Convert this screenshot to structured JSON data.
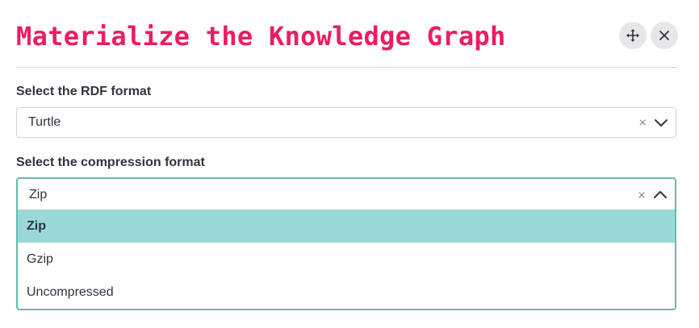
{
  "dialog": {
    "title": "Materialize the Knowledge Graph",
    "move_icon": "move-arrows-icon",
    "close_icon": "close-icon"
  },
  "rdf_format": {
    "label": "Select the RDF format",
    "selected": "Turtle",
    "clear_glyph": "×"
  },
  "compression_format": {
    "label": "Select the compression format",
    "selected": "Zip",
    "clear_glyph": "×",
    "options": [
      "Zip",
      "Gzip",
      "Uncompressed"
    ],
    "highlighted": "Zip"
  },
  "colors": {
    "title": "#e91e63",
    "focus_border": "#5fbfae",
    "highlight": "#9ad8d6"
  }
}
